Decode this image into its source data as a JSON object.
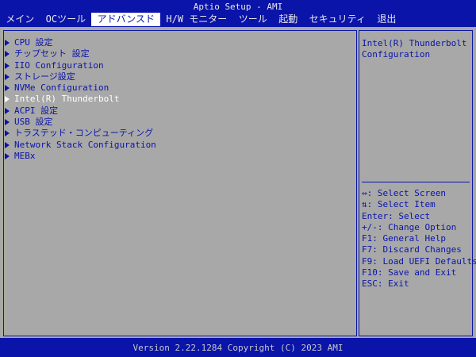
{
  "title": "Aptio Setup - AMI",
  "menu": [
    {
      "label": " メイン ",
      "active": false
    },
    {
      "label": " OCツール ",
      "active": false
    },
    {
      "label": " アドバンスド ",
      "active": true
    },
    {
      "label": " H/W モニター ",
      "active": false
    },
    {
      "label": " ツール ",
      "active": false
    },
    {
      "label": " 起動 ",
      "active": false
    },
    {
      "label": " セキュリティ ",
      "active": false
    },
    {
      "label": " 退出",
      "active": false
    }
  ],
  "items": [
    {
      "label": "CPU 設定",
      "selected": false
    },
    {
      "label": "チップセット 設定",
      "selected": false
    },
    {
      "label": "IIO Configuration",
      "selected": false
    },
    {
      "label": "ストレージ設定",
      "selected": false
    },
    {
      "label": "NVMe Configuration",
      "selected": false
    },
    {
      "label": "Intel(R) Thunderbolt",
      "selected": true
    },
    {
      "label": "ACPI 設定",
      "selected": false
    },
    {
      "label": "USB 設定",
      "selected": false
    },
    {
      "label": "トラステッド・コンピューティング",
      "selected": false
    },
    {
      "label": "Network Stack Configuration",
      "selected": false
    },
    {
      "label": "MEBx",
      "selected": false
    }
  ],
  "help": {
    "text": "Intel(R) Thunderbolt\nConfiguration"
  },
  "keys": [
    "↔: Select Screen",
    "⇅: Select Item",
    "Enter: Select",
    "+/-: Change Option",
    "F1: General Help",
    "F7: Discard Changes",
    "F9: Load UEFI Defaults",
    "F10: Save and Exit",
    "ESC: Exit"
  ],
  "footer": "Version 2.22.1284 Copyright (C) 2023 AMI",
  "colors": {
    "background_blue": "#0a14a8",
    "panel_gray": "#a8a8a8",
    "selected_text": "#ffffff"
  }
}
